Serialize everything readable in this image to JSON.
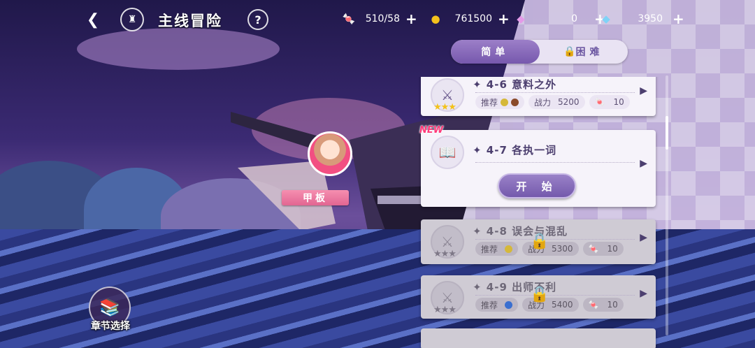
{
  "header": {
    "title": "主线冒险",
    "back_icon": "back-arrow-icon",
    "home_icon": "castle-icon",
    "help_icon": "?"
  },
  "resources": [
    {
      "name": "candy",
      "icon": "🍬",
      "value": "510/58",
      "plus": "+"
    },
    {
      "name": "gold",
      "icon": "●",
      "value": "761500",
      "plus": "+"
    },
    {
      "name": "pink-gem",
      "icon": "◆",
      "value": "0",
      "plus": "+"
    },
    {
      "name": "diamond",
      "icon": "◆",
      "value": "3950",
      "plus": "+"
    }
  ],
  "tabs": {
    "easy": "简单",
    "hard": "困难",
    "active": "easy"
  },
  "stages": [
    {
      "name": "✦ 4-6 意料之外",
      "stars": "★★★",
      "recommend": "推荐",
      "power_label": "战力",
      "power": "5200",
      "cost": "10",
      "state": "cleared"
    },
    {
      "name": "✦ 4-7 各执一词",
      "state": "current",
      "badge": "NEW",
      "start_label": "开 始"
    },
    {
      "name": "✦ 4-8 误会与混乱",
      "stars": "★★★",
      "recommend": "推荐",
      "power_label": "战力",
      "power": "5300",
      "cost": "10",
      "state": "locked"
    },
    {
      "name": "✦ 4-9 出师不利",
      "stars": "★★★",
      "recommend": "推荐",
      "power_label": "战力",
      "power": "5400",
      "cost": "10",
      "state": "locked"
    }
  ],
  "map": {
    "location_label": "甲板"
  },
  "chapter": {
    "label": "章节选择"
  },
  "colors": {
    "accent": "#7658ad",
    "new_badge": "#ff3a7a",
    "location_tag": "#e26592",
    "star": "#f3c21a"
  }
}
